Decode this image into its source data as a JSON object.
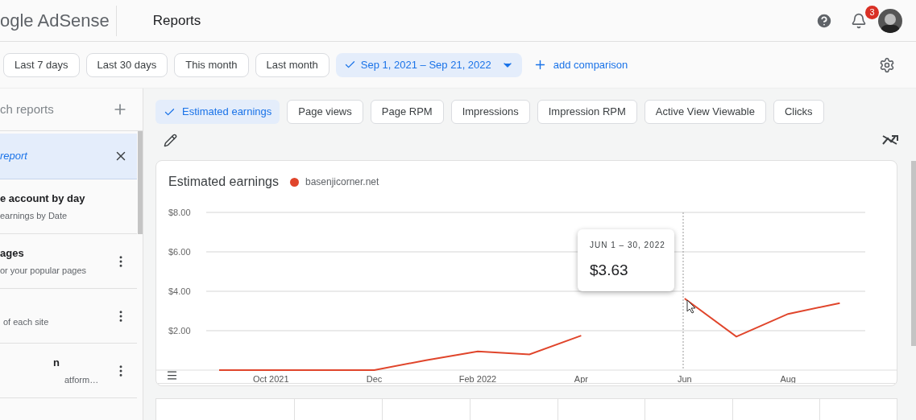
{
  "header": {
    "logo": "ogle AdSense",
    "title": "Reports",
    "notifications": "3"
  },
  "date_presets": [
    {
      "label": "Last 7 days",
      "selected": false
    },
    {
      "label": "Last 30 days",
      "selected": false
    },
    {
      "label": "This month",
      "selected": false
    },
    {
      "label": "Last month",
      "selected": false
    },
    {
      "label": "Sep 1, 2021 – Sep 21, 2022",
      "selected": true
    }
  ],
  "add_comparison": "add comparison",
  "sidebar": {
    "search_placeholder": "ch reports",
    "items": [
      {
        "title": "report",
        "selected": true
      },
      {
        "title": "e account by day",
        "subtitle": "earnings by Date",
        "selected": false
      },
      {
        "title": "ages",
        "subtitle": "or your popular pages",
        "selected": false
      },
      {
        "subtitle": "of each site",
        "selected": false
      },
      {
        "title": "n",
        "subtitle": "atform…",
        "selected": false
      }
    ]
  },
  "metrics": [
    {
      "label": "Estimated earnings",
      "selected": true
    },
    {
      "label": "Page views",
      "selected": false
    },
    {
      "label": "Page RPM",
      "selected": false
    },
    {
      "label": "Impressions",
      "selected": false
    },
    {
      "label": "Impression RPM",
      "selected": false
    },
    {
      "label": "Active View Viewable",
      "selected": false
    },
    {
      "label": "Clicks",
      "selected": false
    }
  ],
  "chart": {
    "title": "Estimated earnings",
    "tooltip": {
      "period": "JUN 1 – 30, 2022",
      "value": "$3.63"
    },
    "chart_data": {
      "type": "line",
      "categories": [
        null,
        "Oct 2021",
        null,
        "Dec",
        null,
        "Feb 2022",
        null,
        "Apr",
        null,
        "Jun",
        null,
        "Aug",
        null
      ],
      "series": [
        {
          "name": "basenjicorner.net",
          "color": "#e0452b",
          "values": [
            0,
            0,
            0,
            0,
            0.5,
            0.95,
            0.8,
            1.75,
            null,
            3.63,
            1.7,
            2.85,
            3.4
          ]
        }
      ],
      "ylim": [
        0,
        8
      ],
      "grid": true,
      "yticks": [
        {
          "value": 2,
          "label": "$2.00"
        },
        {
          "value": 4,
          "label": "$4.00"
        },
        {
          "value": 6,
          "label": "$6.00"
        },
        {
          "value": 8,
          "label": "$8.00"
        }
      ]
    }
  }
}
